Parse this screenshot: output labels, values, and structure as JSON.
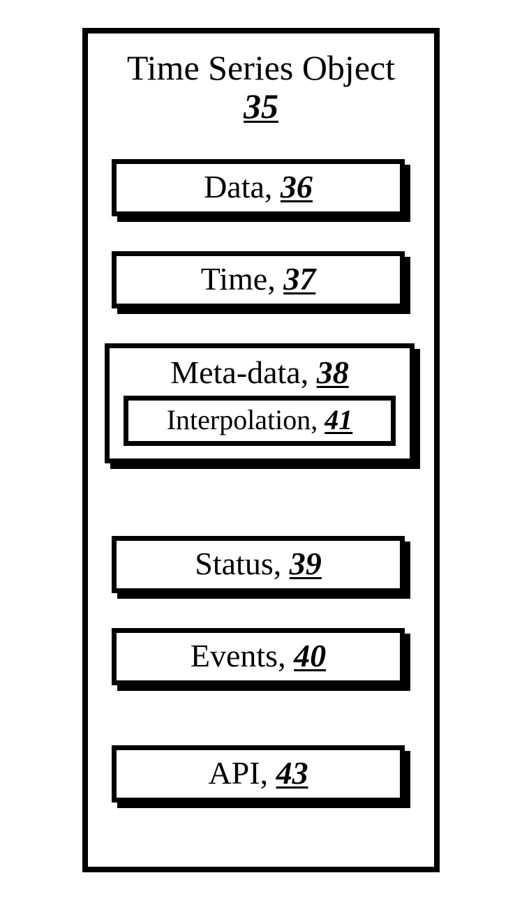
{
  "title": {
    "label": "Time Series Object",
    "ref": "35"
  },
  "boxes": {
    "data": {
      "label": "Data",
      "ref": "36"
    },
    "time": {
      "label": "Time",
      "ref": "37"
    },
    "meta": {
      "label": "Meta-data",
      "ref": "38"
    },
    "interp": {
      "label": "Interpolation",
      "ref": "41"
    },
    "status": {
      "label": "Status",
      "ref": "39"
    },
    "events": {
      "label": "Events",
      "ref": "40"
    },
    "api": {
      "label": "API",
      "ref": "43"
    }
  }
}
